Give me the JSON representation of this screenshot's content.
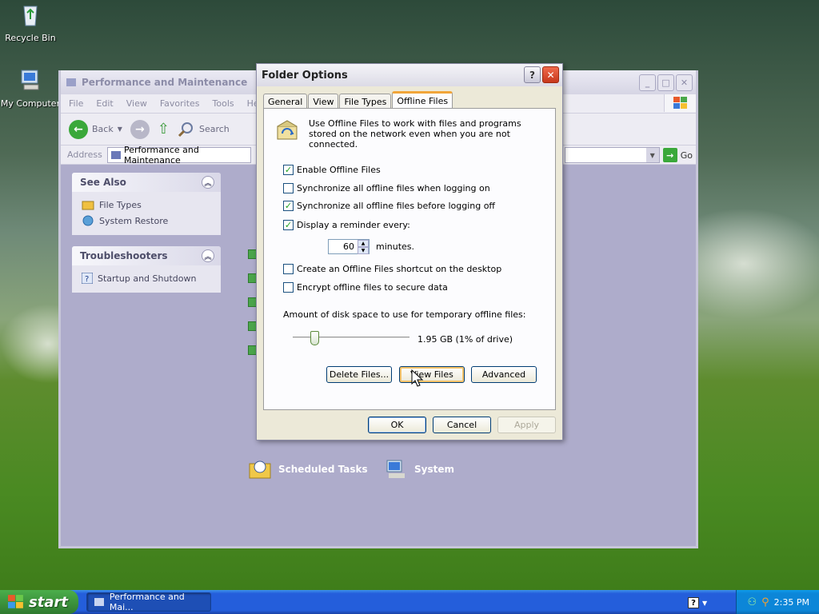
{
  "desktop": {
    "icons": [
      {
        "label": "Recycle Bin"
      },
      {
        "label": "My Computer"
      }
    ]
  },
  "explorer": {
    "title": "Performance and Maintenance",
    "menu": [
      "File",
      "Edit",
      "View",
      "Favorites",
      "Tools",
      "Help"
    ],
    "toolbar": {
      "back": "Back",
      "search": "Search"
    },
    "address_label": "Address",
    "address_value": "Performance and Maintenance",
    "go": "Go",
    "see_also": {
      "title": "See Also",
      "items": [
        "File Types",
        "System Restore"
      ]
    },
    "troubleshooters": {
      "title": "Troubleshooters",
      "items": [
        "Startup and Shutdown"
      ]
    },
    "tasks": [
      "Scheduled Tasks",
      "System"
    ]
  },
  "dialog": {
    "title": "Folder Options",
    "tabs": [
      "General",
      "View",
      "File Types",
      "Offline Files"
    ],
    "active_tab": "Offline Files",
    "info_text": "Use Offline Files to work with files and programs stored on the network even when you are not connected.",
    "options": {
      "enable": {
        "label": "Enable Offline Files",
        "checked": true
      },
      "sync_logon": {
        "label": "Synchronize all offline files when logging on",
        "checked": false
      },
      "sync_logoff": {
        "label": "Synchronize all offline files before logging off",
        "checked": true
      },
      "reminder": {
        "label": "Display a reminder every:",
        "checked": true
      },
      "shortcut": {
        "label": "Create an Offline Files shortcut on the desktop",
        "checked": false
      },
      "encrypt": {
        "label": "Encrypt offline files to secure data",
        "checked": false
      }
    },
    "reminder_value": "60",
    "reminder_unit": "minutes.",
    "disk_label": "Amount of disk space to use for temporary offline files:",
    "disk_value": "1.95 GB (1% of drive)",
    "disk_slider_fraction": 0.16,
    "buttons": {
      "delete_files": "Delete Files...",
      "view_files": "View Files",
      "advanced": "Advanced",
      "ok": "OK",
      "cancel": "Cancel",
      "apply": "Apply"
    }
  },
  "taskbar": {
    "start": "start",
    "task": "Performance and Mai...",
    "clock": "2:35 PM"
  }
}
